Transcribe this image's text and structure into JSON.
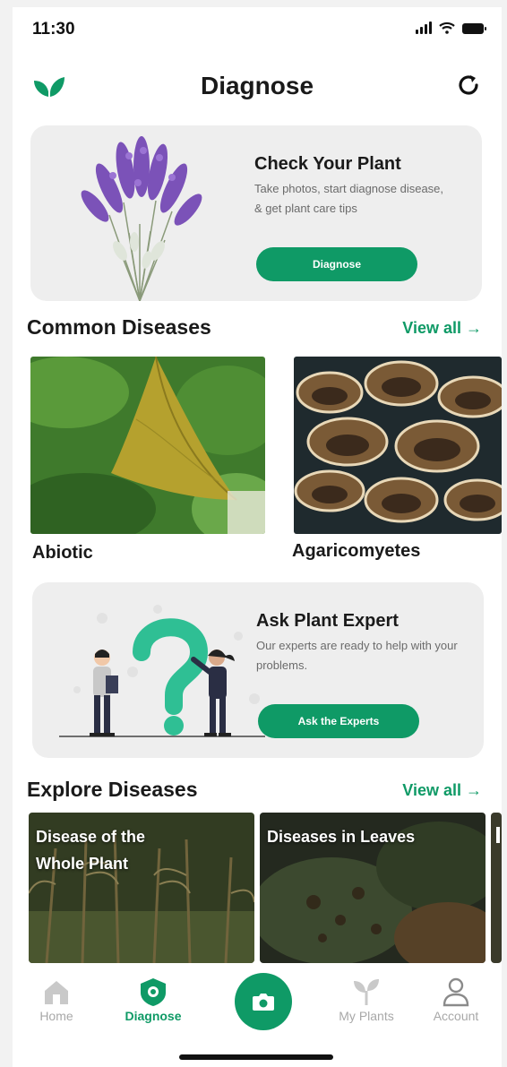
{
  "status_bar": {
    "time": "11:30"
  },
  "header": {
    "title": "Diagnose"
  },
  "check_plant_card": {
    "title": "Check Your Plant",
    "description": "Take photos, start diagnose disease, & get plant care tips",
    "button_label": "Diagnose"
  },
  "common_diseases": {
    "title": "Common Diseases",
    "view_all": "View all →",
    "items": [
      {
        "label": "Abiotic"
      },
      {
        "label": "Agaricomyetes"
      }
    ]
  },
  "expert_card": {
    "title": "Ask Plant Expert",
    "description": "Our experts are ready to help with your problems.",
    "button_label": "Ask the Experts"
  },
  "explore_diseases": {
    "title": "Explore Diseases",
    "view_all": "View all →",
    "items": [
      {
        "label": "Disease of the\nWhole Plant"
      },
      {
        "label": "Diseases in Leaves"
      }
    ]
  },
  "bottom_nav": {
    "items": [
      {
        "label": "Home",
        "icon": "home-icon",
        "active": false
      },
      {
        "label": "Diagnose",
        "icon": "diagnose-shield-icon",
        "active": true
      },
      {
        "label": "",
        "icon": "camera-icon",
        "active": false
      },
      {
        "label": "My Plants",
        "icon": "sprout-icon",
        "active": false
      },
      {
        "label": "Account",
        "icon": "user-icon",
        "active": false
      }
    ]
  },
  "colors": {
    "accent": "#0f9a66",
    "card_bg": "#eeeeee",
    "muted_text": "#6b6b6b",
    "nav_inactive": "#a8a8a8"
  }
}
